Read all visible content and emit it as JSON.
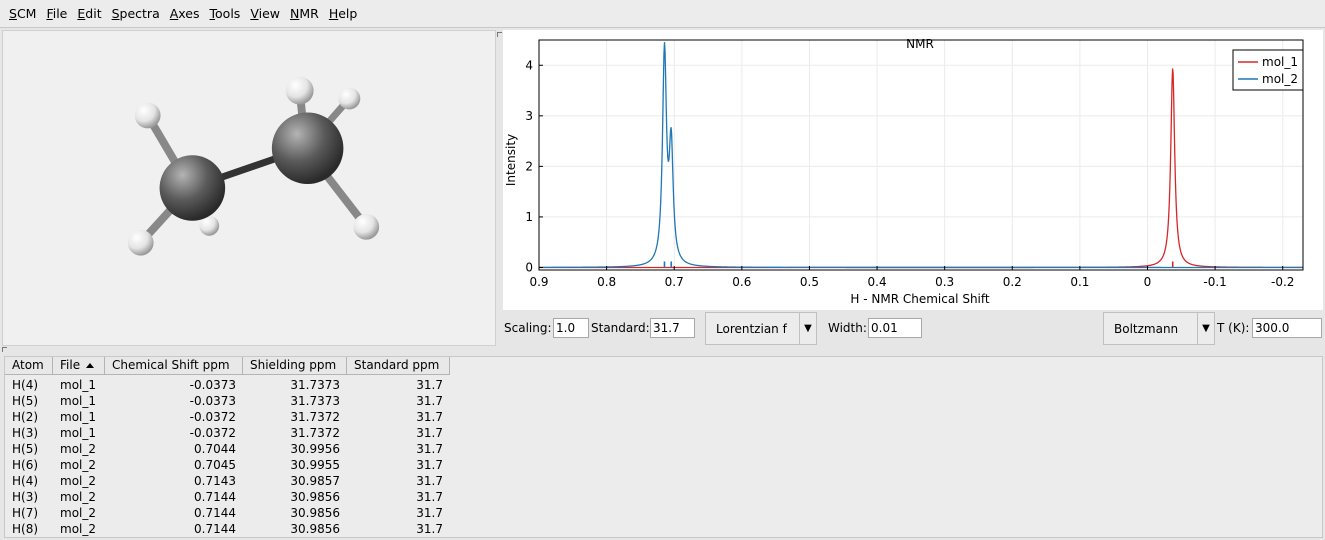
{
  "menu": [
    "SCM",
    "File",
    "Edit",
    "Spectra",
    "Axes",
    "Tools",
    "View",
    "NMR",
    "Help"
  ],
  "chart_data": {
    "type": "line",
    "title": "NMR",
    "xlabel": "H - NMR Chemical Shift",
    "ylabel": "Intensity",
    "xlim": [
      0.9,
      -0.23
    ],
    "ylim": [
      -0.05,
      4.5
    ],
    "x_ticks": [
      "0.9",
      "0.8",
      "0.7",
      "0.6",
      "0.5",
      "0.4",
      "0.3",
      "0.2",
      "0.1",
      "0",
      "-0.1",
      "-0.2"
    ],
    "x_tick_values": [
      0.9,
      0.8,
      0.7,
      0.6,
      0.5,
      0.4,
      0.3,
      0.2,
      0.1,
      0,
      -0.1,
      -0.2
    ],
    "y_ticks": [
      "0",
      "1",
      "2",
      "3",
      "4"
    ],
    "y_tick_values": [
      0,
      1,
      2,
      3,
      4
    ],
    "grid": true,
    "legend_position": "top-right",
    "series": [
      {
        "name": "mol_1",
        "color": "#d62728",
        "peaks": [
          {
            "shift": -0.0373,
            "height": 3.95
          }
        ],
        "sticks": [
          -0.0373
        ]
      },
      {
        "name": "mol_2",
        "color": "#1f77b4",
        "peaks": [
          {
            "shift": 0.7144,
            "height": 4.2
          },
          {
            "shift": 0.7045,
            "height": 2.3
          }
        ],
        "sticks": [
          0.7044,
          0.7144
        ]
      }
    ]
  },
  "controls": {
    "scaling_label": "Scaling:",
    "scaling_value": "1.0",
    "standard_label": "Standard:",
    "standard_value": "31.7",
    "lineshape": "Lorentzian f",
    "width_label": "Width:",
    "width_value": "0.01",
    "weighting": "Boltzmann",
    "temp_label": "T (K):",
    "temp_value": "300.0"
  },
  "table": {
    "headers": [
      "Atom",
      "File",
      "Chemical Shift ppm",
      "Shielding ppm",
      "Standard ppm"
    ],
    "rows": [
      [
        "H(4)",
        "mol_1",
        "-0.0373",
        "31.7373",
        "31.7"
      ],
      [
        "H(5)",
        "mol_1",
        "-0.0373",
        "31.7373",
        "31.7"
      ],
      [
        "H(2)",
        "mol_1",
        "-0.0372",
        "31.7372",
        "31.7"
      ],
      [
        "H(3)",
        "mol_1",
        "-0.0372",
        "31.7372",
        "31.7"
      ],
      [
        "H(5)",
        "mol_2",
        "0.7044",
        "30.9956",
        "31.7"
      ],
      [
        "H(6)",
        "mol_2",
        "0.7045",
        "30.9955",
        "31.7"
      ],
      [
        "H(4)",
        "mol_2",
        "0.7143",
        "30.9857",
        "31.7"
      ],
      [
        "H(3)",
        "mol_2",
        "0.7144",
        "30.9856",
        "31.7"
      ],
      [
        "H(7)",
        "mol_2",
        "0.7144",
        "30.9856",
        "31.7"
      ],
      [
        "H(8)",
        "mol_2",
        "0.7144",
        "30.9856",
        "31.7"
      ]
    ]
  }
}
